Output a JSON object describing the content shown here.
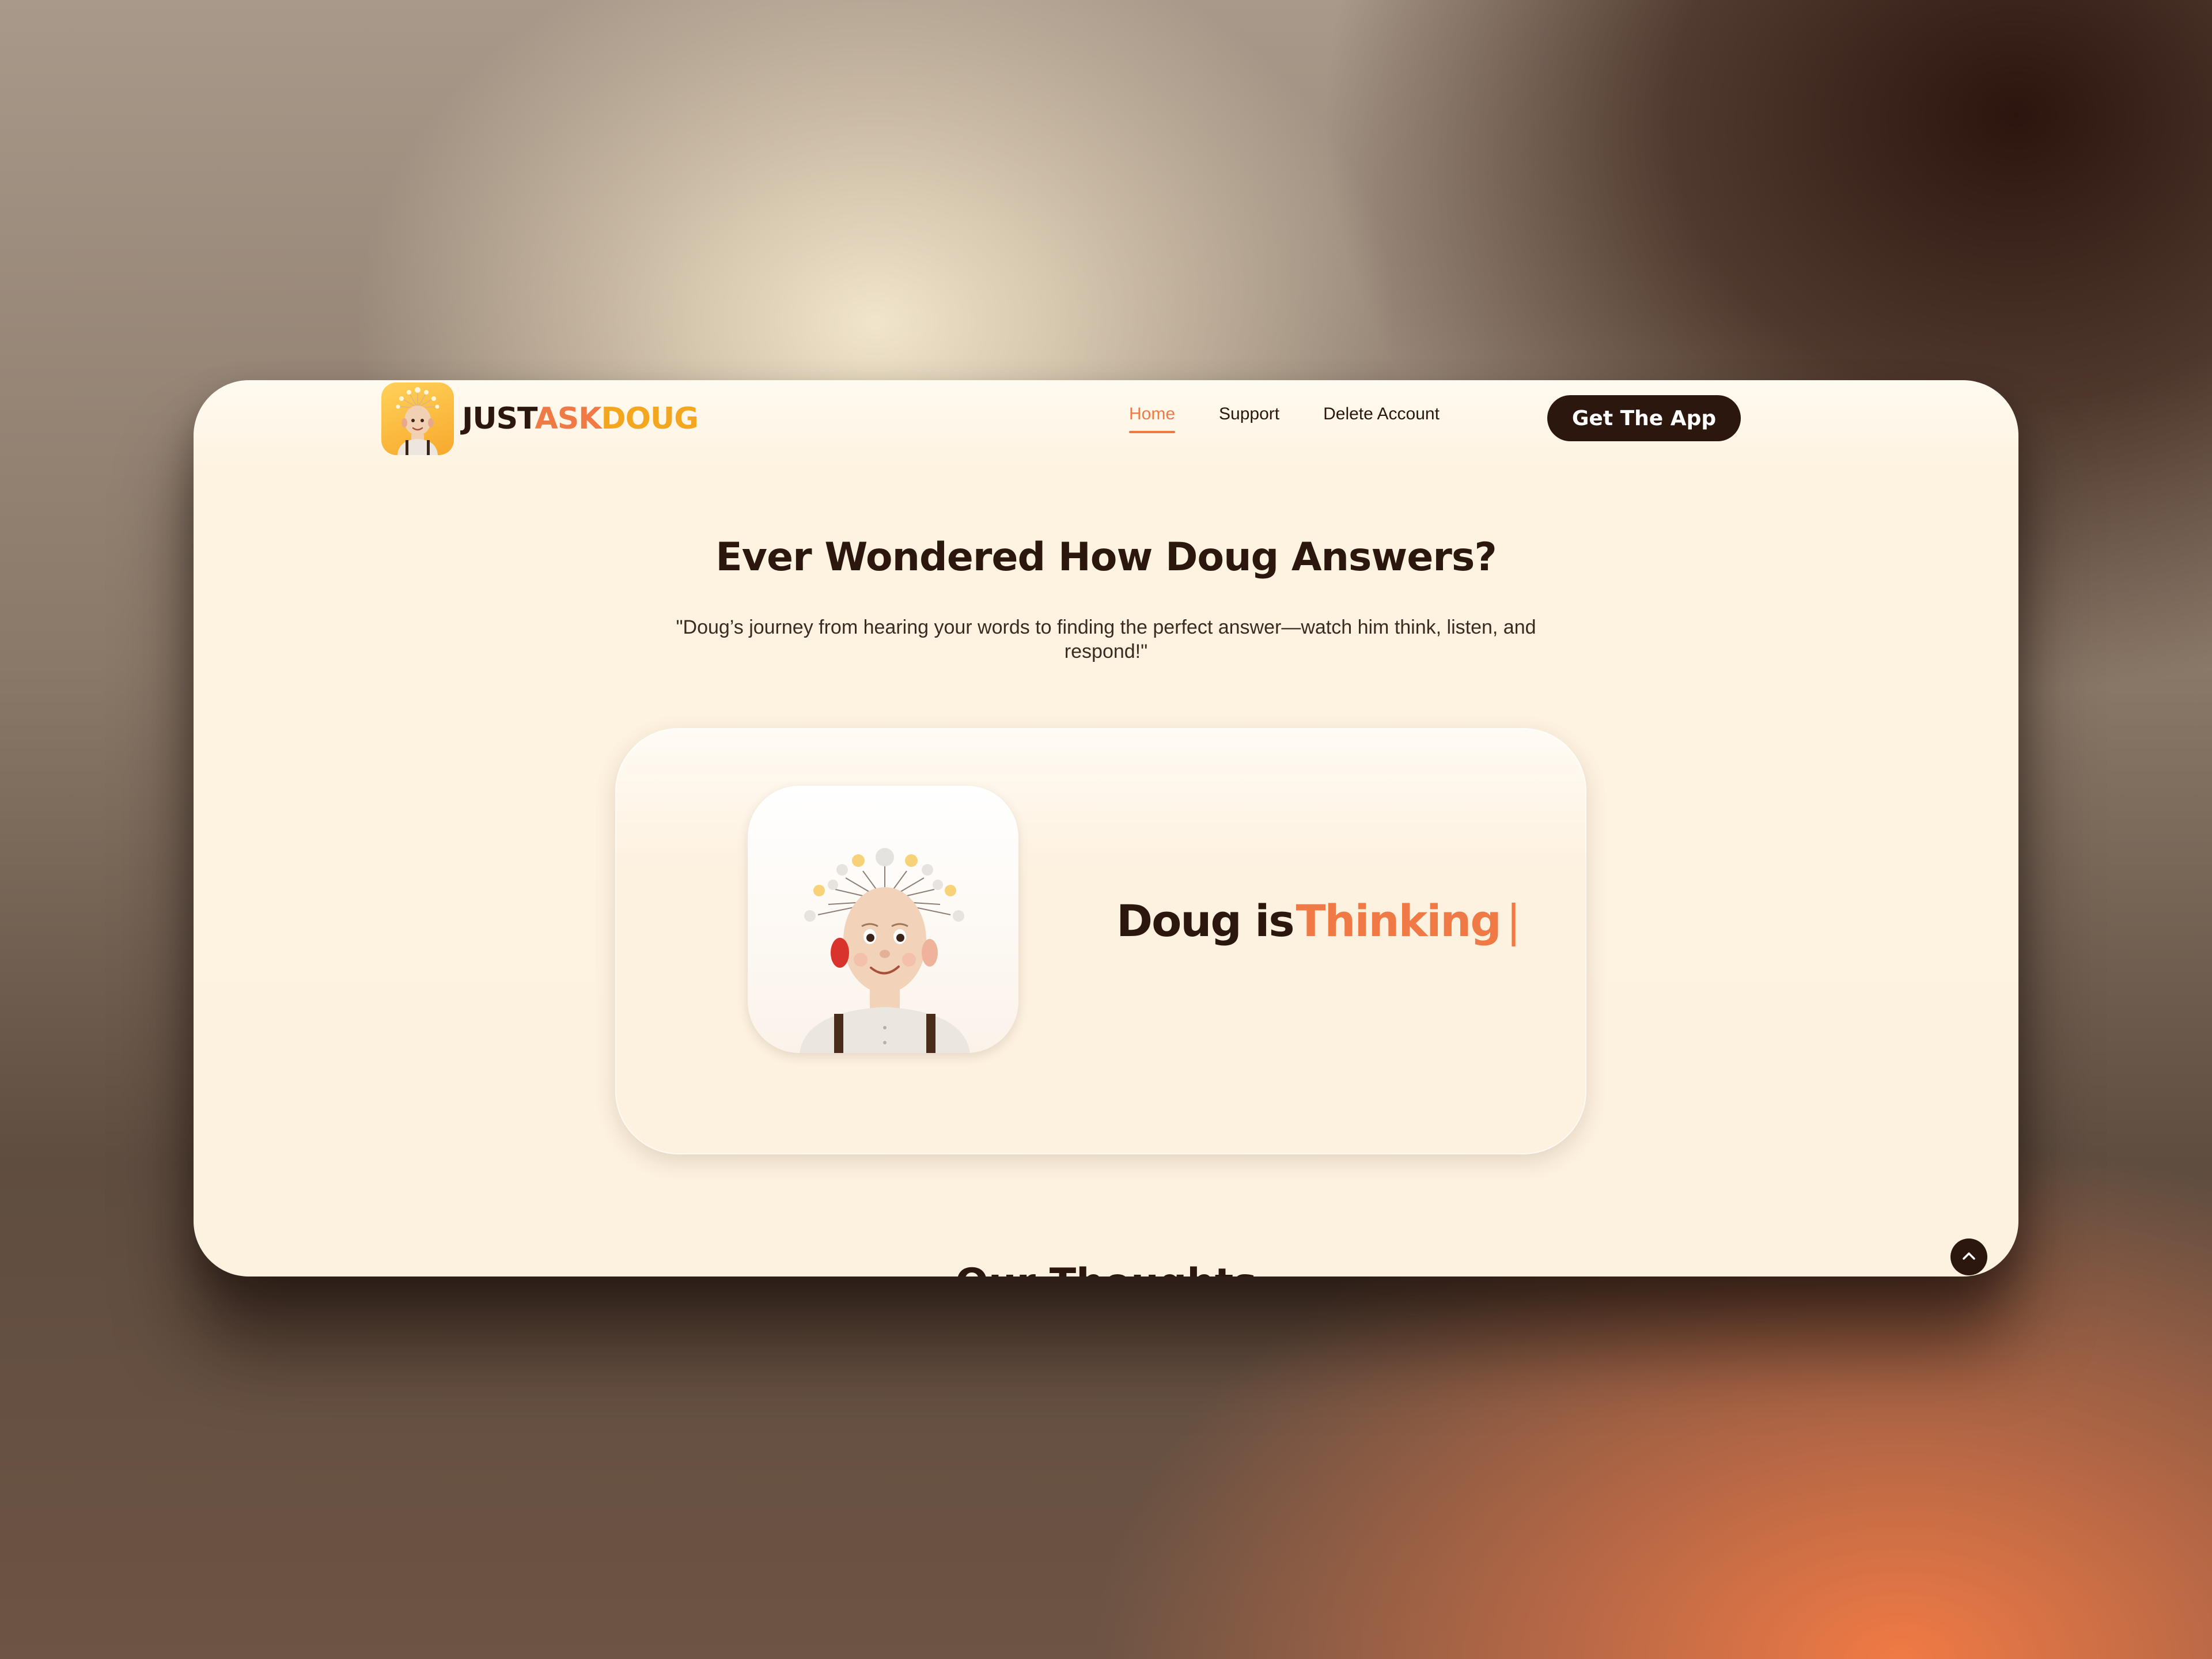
{
  "brand": {
    "logo_part1": "JUST",
    "logo_part2": "ASK",
    "logo_part3": "DOUG",
    "logo_icon": "doug-avatar-icon"
  },
  "nav": {
    "items": [
      {
        "label": "Home",
        "active": true
      },
      {
        "label": "Support",
        "active": false
      },
      {
        "label": "Delete Account",
        "active": false
      }
    ],
    "cta_label": "Get The App"
  },
  "hero": {
    "title": "Ever Wondered How Doug Answers?",
    "subtitle": "\"Doug’s journey from hearing your words to finding the perfect answer—watch him think, listen, and respond!\""
  },
  "demo": {
    "prefix": "Doug is",
    "state": "Thinking",
    "caret": "|",
    "avatar_icon": "doug-thinking-icon"
  },
  "next_section": {
    "title": "Our Thoughts"
  },
  "controls": {
    "scroll_top_icon": "chevron-up-icon"
  },
  "colors": {
    "accent": "#f07a45",
    "dark": "#2c170f",
    "logo_yellow": "#f4a71e",
    "cream": "#fdf1df"
  }
}
